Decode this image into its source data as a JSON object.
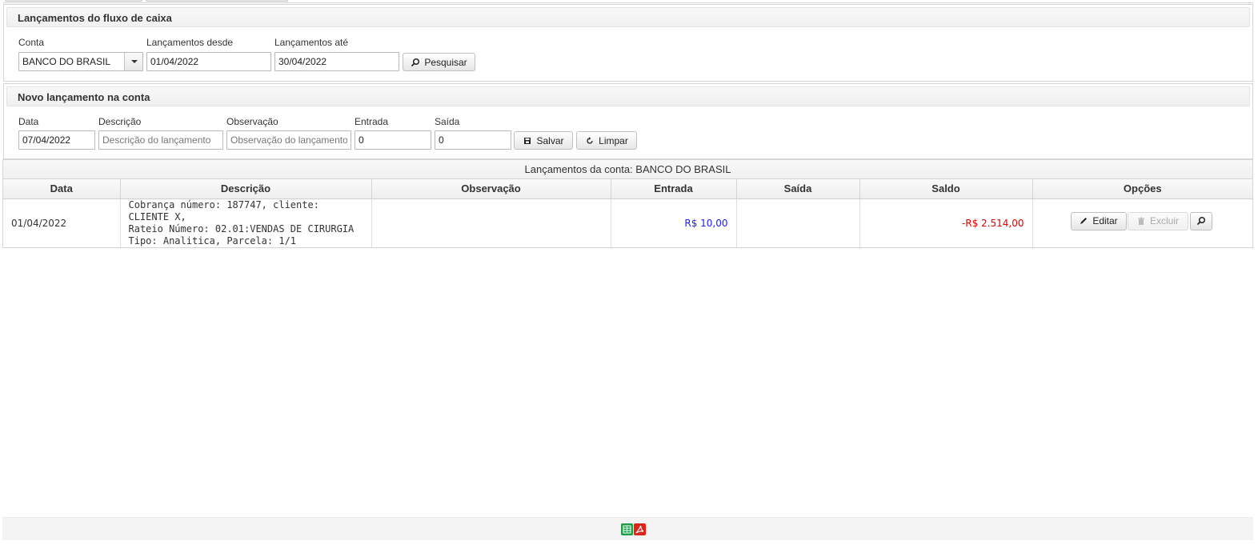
{
  "filter": {
    "title": "Lançamentos do fluxo de caixa",
    "account_label": "Conta",
    "account_value": "BANCO DO BRASIL",
    "from_label": "Lançamentos desde",
    "from_value": "01/04/2022",
    "to_label": "Lançamentos até",
    "to_value": "30/04/2022",
    "search_label": "Pesquisar"
  },
  "new_entry": {
    "title": "Novo lançamento na conta",
    "date_label": "Data",
    "date_value": "07/04/2022",
    "desc_label": "Descrição",
    "desc_placeholder": "Descrição do lançamento",
    "obs_label": "Observação",
    "obs_placeholder": "Observação do lançamento",
    "in_label": "Entrada",
    "in_value": "0",
    "out_label": "Saída",
    "out_value": "0",
    "save_label": "Salvar",
    "clear_label": "Limpar"
  },
  "table": {
    "caption": "Lançamentos da conta: BANCO DO BRASIL",
    "columns": [
      "Data",
      "Descrição",
      "Observação",
      "Entrada",
      "Saída",
      "Saldo",
      "Opções"
    ],
    "rows": [
      {
        "date": "01/04/2022",
        "desc_lines": [
          "Cobrança número: 187747, cliente: CLIENTE X,",
          "Rateio Número: 02.01:VENDAS DE CIRURGIA",
          "Tipo: Analitica, Parcela: 1/1"
        ],
        "obs": "",
        "in": "R$ 10,00",
        "out": "",
        "balance": "-R$ 2.514,00",
        "edit_label": "Editar",
        "delete_label": "Excluir"
      }
    ]
  },
  "colors": {
    "positive": "#1a1aff",
    "negative": "#e00000",
    "excel": "#1f9e4a",
    "pdf": "#d9261c"
  },
  "icons": [
    "search-icon",
    "save-icon",
    "refresh-icon",
    "pencil-icon",
    "trash-icon",
    "excel-icon",
    "pdf-icon"
  ]
}
